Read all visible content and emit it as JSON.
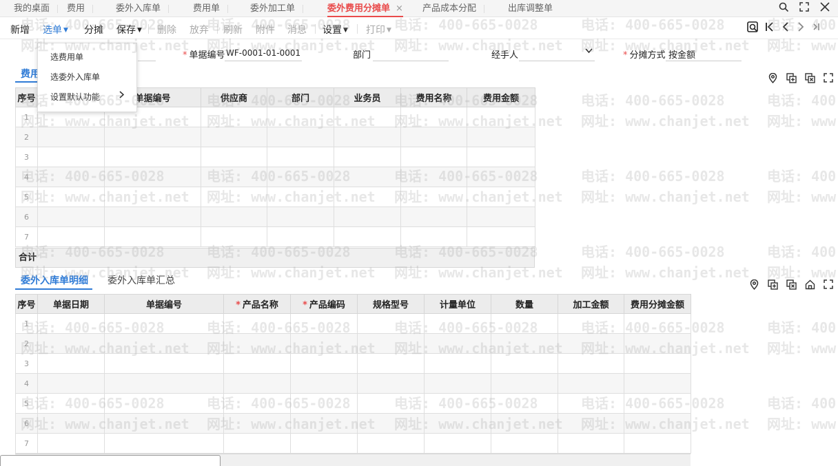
{
  "tabs": [
    {
      "label": "我的桌面"
    },
    {
      "label": "费用"
    },
    {
      "label": "委外入库单"
    },
    {
      "label": "费用单"
    },
    {
      "label": "委外加工单"
    },
    {
      "label": "委外费用分摊单",
      "active": true,
      "close": "×"
    },
    {
      "label": "产品成本分配"
    },
    {
      "label": "出库调整单"
    }
  ],
  "window_controls": {
    "search": "search-icon",
    "fullscreen": "fullscreen-icon",
    "close": "close-icon"
  },
  "toolbar": {
    "new": "新增",
    "select": "选单",
    "allocate": "分摊",
    "save": "保存",
    "delete": "删除",
    "discard": "放弃",
    "refresh": "刷新",
    "attach": "附件",
    "message": "消息",
    "settings": "设置",
    "print": "打印"
  },
  "select_menu": {
    "items": [
      "选费用单",
      "选委外入库单",
      "设置默认功能"
    ]
  },
  "form": {
    "doc_no_label": "单据编号",
    "doc_no_value": "WF-0001-01-0001",
    "dept_label": "部门",
    "handler_label": "经手人",
    "method_label": "分摊方式",
    "method_value": "按金额"
  },
  "expense_section": {
    "tab_label": "费用",
    "columns": [
      "序号",
      "",
      "单据编号",
      "供应商",
      "部门",
      "业务员",
      "费用名称",
      "费用金额"
    ],
    "rows": [
      "1",
      "2",
      "3",
      "4",
      "5",
      "6",
      "7"
    ],
    "total_label": "合计"
  },
  "inbound_section": {
    "tabs": [
      "委外入库单明细",
      "委外入库单汇总"
    ],
    "columns": [
      "序号",
      "单据日期",
      "单据编号",
      "产品名称",
      "产品编码",
      "规格型号",
      "计量单位",
      "数量",
      "加工金额",
      "费用分摊金额"
    ],
    "required_columns": [
      "产品名称",
      "产品编码"
    ],
    "rows": [
      "1",
      "2",
      "3",
      "4",
      "5",
      "6",
      "7"
    ]
  },
  "watermark": {
    "phone": "电话: 400-665-0028",
    "site": "网址: www.chanjet.net"
  },
  "colors": {
    "accent_red": "#e94b4b",
    "accent_blue": "#2f7bd6"
  }
}
